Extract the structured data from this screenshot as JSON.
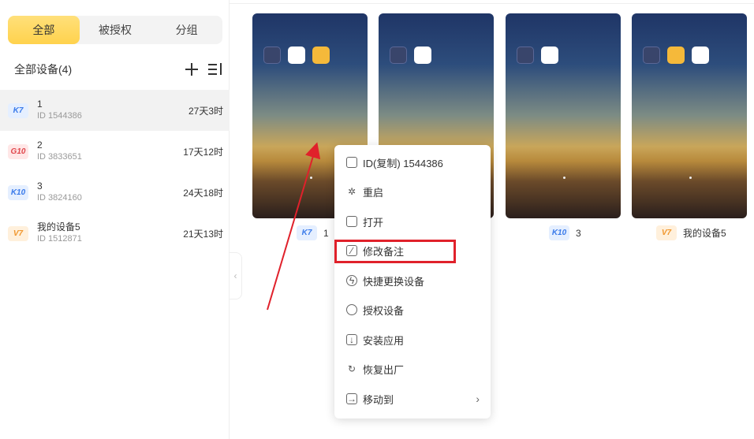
{
  "sidebar": {
    "tabs": [
      {
        "label": "全部",
        "active": true
      },
      {
        "label": "被授权",
        "active": false
      },
      {
        "label": "分组",
        "active": false
      }
    ],
    "section_title": "全部设备(4)",
    "devices": [
      {
        "badge": "K7",
        "name": "1",
        "id": "ID 1544386",
        "time": "27天3时",
        "selected": true
      },
      {
        "badge": "G10",
        "name": "2",
        "id": "ID 3833651",
        "time": "17天12时",
        "selected": false
      },
      {
        "badge": "K10",
        "name": "3",
        "id": "ID 3824160",
        "time": "24天18时",
        "selected": false
      },
      {
        "badge": "V7",
        "name": "我的设备5",
        "id": "ID 1512871",
        "time": "21天13时",
        "selected": false
      }
    ],
    "collapse_glyph": "‹"
  },
  "phones": [
    {
      "badge": "K7",
      "label": "1"
    },
    {
      "badge": "K10",
      "label": "3"
    },
    {
      "badge": "V7",
      "label": "我的设备5"
    }
  ],
  "context_menu": {
    "items": [
      {
        "icon": "copy-icon",
        "label": "ID(复制) 1544386"
      },
      {
        "icon": "restart-icon",
        "label": "重启"
      },
      {
        "icon": "folder-open-icon",
        "label": "打开"
      },
      {
        "icon": "edit-note-icon",
        "label": "修改备注"
      },
      {
        "icon": "quick-switch-icon",
        "label": "快捷更换设备"
      },
      {
        "icon": "user-authorize-icon",
        "label": "授权设备"
      },
      {
        "icon": "install-app-icon",
        "label": "安装应用"
      },
      {
        "icon": "factory-reset-icon",
        "label": "恢复出厂"
      },
      {
        "icon": "move-to-icon",
        "label": "移动到"
      }
    ],
    "highlighted": "修改备注",
    "submenu_glyph": "›"
  },
  "colors": {
    "active_tab": "#ffd24d",
    "highlight_box": "#e0212b",
    "annotation_arrow": "#e0212b",
    "badge_blue": "#3b7bea",
    "badge_red": "#e0484d",
    "badge_orange": "#f0962d"
  }
}
